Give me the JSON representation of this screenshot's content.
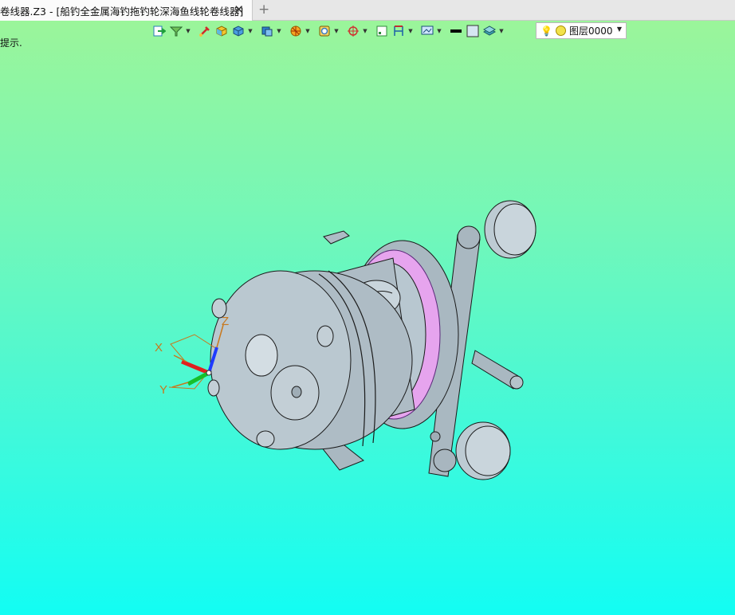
{
  "tabbar": {
    "tab_title": "卷线器.Z3 - [船钓全金属海钓拖钓轮深海鱼线轮卷线器]",
    "close_glyph": "✕",
    "add_glyph": "+"
  },
  "toolbar": {
    "icons": [
      "exit-sketch-icon",
      "filter-icon",
      "pick-icon",
      "shade-icon",
      "render-mode-icon",
      "view-cube-icon",
      "orient-icon",
      "zoom-fit-icon",
      "snap-icon",
      "grid-icon",
      "measure-icon",
      "display-icon",
      "line-color-icon",
      "face-color-icon",
      "layer-icon"
    ]
  },
  "layer": {
    "name": "图层0000"
  },
  "hint": {
    "text": "提示."
  },
  "triad": {
    "x_label": "X",
    "y_label": "Y",
    "z_label": "Z"
  },
  "colors": {
    "bg_top": "#9bf59a",
    "bg_bottom": "#12fdf3",
    "model_fill": "#b8c7d0",
    "model_edge": "#1a1a1a",
    "highlight": "#e6a4ee",
    "axis_x": "#e02020",
    "axis_y": "#16c02a",
    "axis_z": "#1f3bff",
    "axis_label": "#c8781d"
  }
}
